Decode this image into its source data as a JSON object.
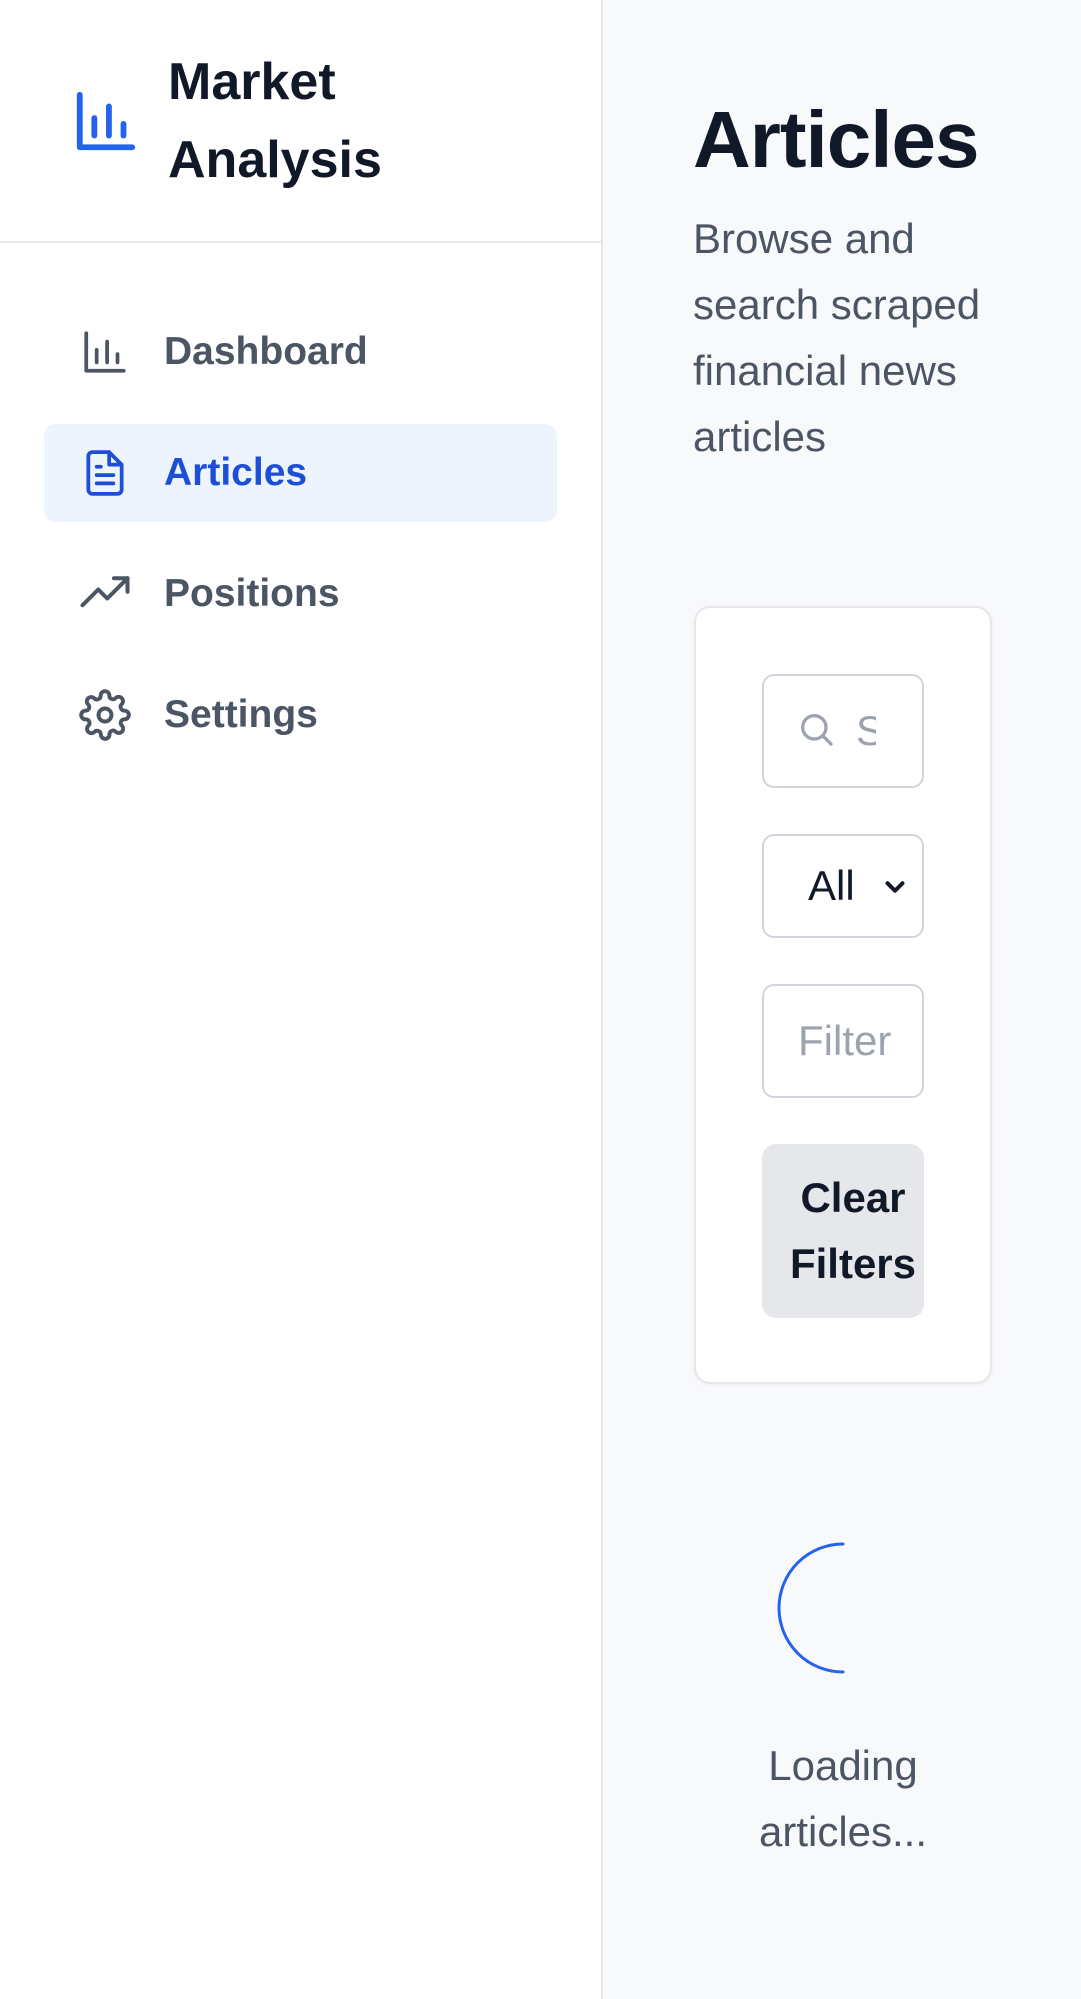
{
  "brand": {
    "title": "Market Analysis"
  },
  "nav": {
    "items": [
      {
        "label": "Dashboard",
        "icon": "bar-chart-icon",
        "active": false
      },
      {
        "label": "Articles",
        "icon": "document-icon",
        "active": true
      },
      {
        "label": "Positions",
        "icon": "trending-up-icon",
        "active": false
      },
      {
        "label": "Settings",
        "icon": "gear-icon",
        "active": false
      }
    ]
  },
  "page": {
    "title": "Articles",
    "subtitle": "Browse and search scraped financial news articles"
  },
  "filters": {
    "search_placeholder": "Search",
    "source_select_value": "All",
    "date_placeholder": "Filter",
    "clear_label": "Clear Filters"
  },
  "loading": {
    "text": "Loading articles..."
  },
  "colors": {
    "accent": "#2563eb",
    "active_bg": "#eef4fd",
    "text_primary": "#111827",
    "text_muted": "#4b5563"
  }
}
